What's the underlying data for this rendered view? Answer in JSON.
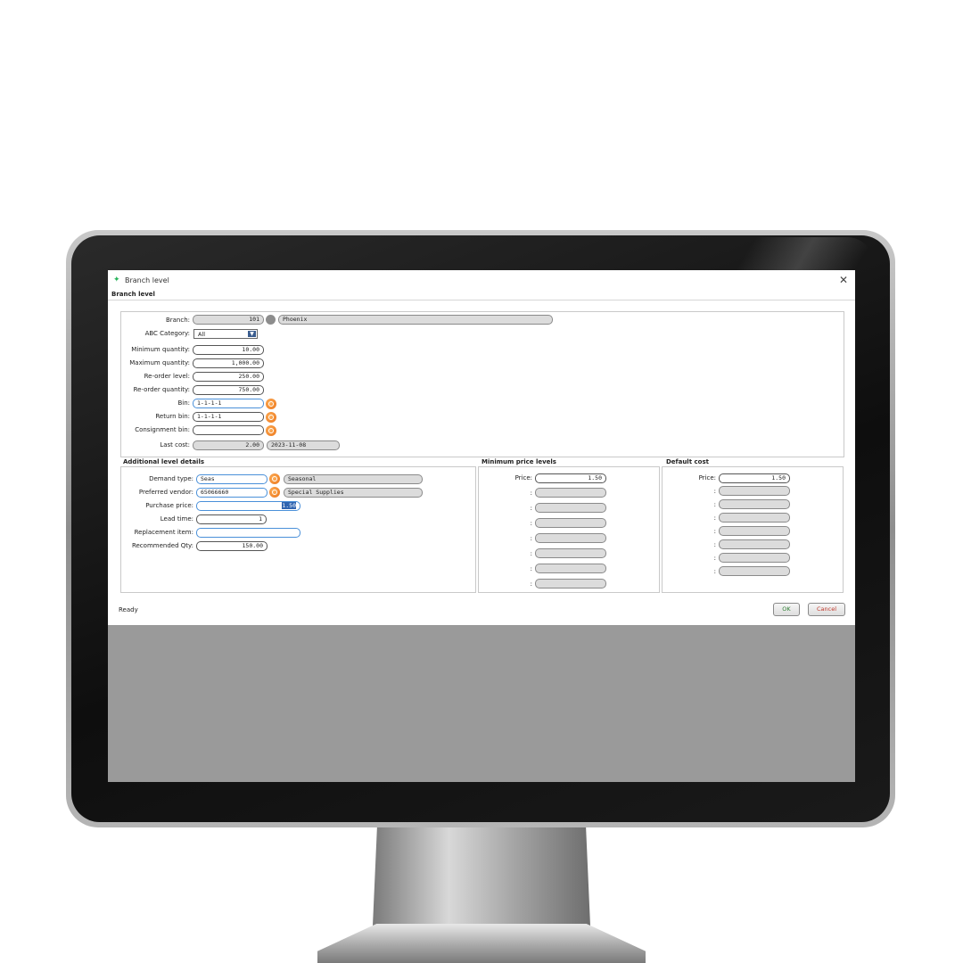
{
  "window": {
    "title": "Branch level",
    "header": "Branch level",
    "close_symbol": "✕"
  },
  "branch_section": {
    "branch_label": "Branch:",
    "branch_value": "101",
    "branch_name": "Phoenix",
    "abc_label": "ABC Category:",
    "abc_value": "All",
    "min_qty_label": "Minimum quantity:",
    "min_qty": "10.00",
    "max_qty_label": "Maximum quantity:",
    "max_qty": "1,000.00",
    "reorder_level_label": "Re-order level:",
    "reorder_level": "250.00",
    "reorder_qty_label": "Re-order quantity:",
    "reorder_qty": "750.00",
    "bin_label": "Bin:",
    "bin": "1-1-1-1",
    "return_bin_label": "Return bin:",
    "return_bin": "1-1-1-1",
    "consignment_bin_label": "Consignment bin:",
    "consignment_bin": "",
    "last_cost_label": "Last cost:",
    "last_cost": "2.00",
    "last_cost_date": "2023-11-08"
  },
  "additional": {
    "title": "Additional level details",
    "demand_type_label": "Demand type:",
    "demand_type": "Seas",
    "demand_type_desc": "Seasonal",
    "vendor_label": "Preferred vendor:",
    "vendor": "65066660",
    "vendor_name": "Special Supplies",
    "purchase_price_label": "Purchase price:",
    "purchase_price": "1.50",
    "lead_time_label": "Lead time:",
    "lead_time": "1",
    "replacement_label": "Replacement item:",
    "replacement": "",
    "recommended_label": "Recommended Qty:",
    "recommended": "150.00"
  },
  "min_price_levels": {
    "title": "Minimum price levels",
    "price_label": "Price:",
    "price": "1.50",
    "level_label": ":"
  },
  "default_cost": {
    "title": "Default cost",
    "price_label": "Price:",
    "price": "1.50",
    "level_label": ":"
  },
  "status": "Ready",
  "ok_label": "OK",
  "cancel_label": "Cancel",
  "colors": {
    "accent_orange": "#e86d12",
    "focus_blue": "#4a90d9",
    "cancel_red": "#c0392b",
    "ok_green": "#2e7d32"
  }
}
